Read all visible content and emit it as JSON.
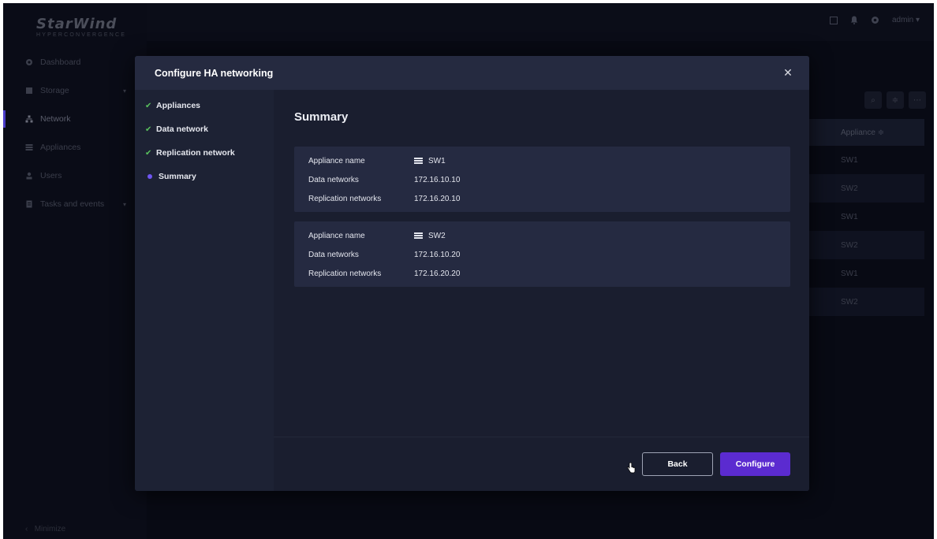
{
  "app": {
    "logo_main": "StarWind",
    "logo_sub": "HYPERCONVERGENCE",
    "user_menu": "admin ▾",
    "minimize_label": "Minimize"
  },
  "sidebar": {
    "items": [
      {
        "label": "Dashboard",
        "icon": "gear-icon"
      },
      {
        "label": "Storage",
        "icon": "storage-icon",
        "chevron": "▾"
      },
      {
        "label": "Network",
        "icon": "network-icon"
      },
      {
        "label": "Appliances",
        "icon": "appliances-icon"
      },
      {
        "label": "Users",
        "icon": "user-icon"
      },
      {
        "label": "Tasks and events",
        "icon": "tasks-icon",
        "chevron": "▾"
      }
    ]
  },
  "background_table": {
    "header": "Appliance ≑",
    "rows": [
      "SW1",
      "SW2",
      "SW1",
      "SW2",
      "SW1",
      "SW2"
    ]
  },
  "modal": {
    "title": "Configure HA networking",
    "close_glyph": "✕",
    "steps": [
      {
        "label": "Appliances",
        "state": "done"
      },
      {
        "label": "Data network",
        "state": "done"
      },
      {
        "label": "Replication network",
        "state": "done"
      },
      {
        "label": "Summary",
        "state": "current"
      }
    ],
    "check_glyph": "✔",
    "summary_title": "Summary",
    "cards": [
      {
        "labels": {
          "appliance": "Appliance name",
          "data": "Data networks",
          "replication": "Replication networks"
        },
        "appliance": "SW1",
        "data": "172.16.10.10",
        "replication": "172.16.20.10"
      },
      {
        "labels": {
          "appliance": "Appliance name",
          "data": "Data networks",
          "replication": "Replication networks"
        },
        "appliance": "SW2",
        "data": "172.16.10.20",
        "replication": "172.16.20.20"
      }
    ],
    "back_label": "Back",
    "configure_label": "Configure"
  },
  "colors": {
    "accent": "#5b2bd0",
    "step_done": "#59c15d",
    "step_current": "#6f56f2"
  }
}
